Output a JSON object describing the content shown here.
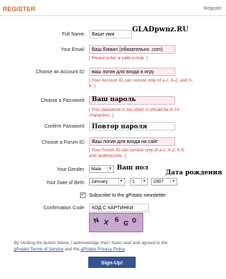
{
  "header": {
    "brand": "REGISTER",
    "link": "Register"
  },
  "watermark": "GLADpwnz.RU",
  "form": {
    "full_name": {
      "label": "Full Name",
      "value": "Ваше имя"
    },
    "email": {
      "label": "Your Email",
      "value": "Ваш Емаил (обязательно .com)",
      "error": "[ Please enter a valid e-mail. ]"
    },
    "account_id": {
      "label": "Choose an Account ID",
      "value": "ваш логин для входа в игру",
      "error": "[ Your Account ID can consist only of a-z, A-Z, and 0-9. ]"
    },
    "password": {
      "label": "Choose a Password",
      "annotation": "Ваш пароль",
      "error": "[ Your password is too short, it should be 6-14 characters. ]"
    },
    "confirm_password": {
      "label": "Confirm Password",
      "annotation": "Повтор пароля"
    },
    "forum_id": {
      "label": "Choose a Forum ID",
      "value": "Ваш логин для входа на сайт",
      "error": "[ Your Forum ID can consist only of a-z, A-Z, 0-9, and underscores. ]"
    },
    "gender": {
      "label": "Your Gender",
      "value": "Male",
      "annotation": "Ваш пол"
    },
    "birth": {
      "label": "Your Date of Birth",
      "month": "January",
      "day": "1",
      "year": "1997",
      "annotation": "Дата рождения"
    },
    "newsletter": {
      "label": "Subscribe to the gPotato newsletter",
      "checked": "✓"
    },
    "confirmation": {
      "label": "Confirmation Code",
      "value": "КОД С КАРТИНКИ"
    }
  },
  "captcha": {
    "chars": [
      "N",
      "X",
      "6",
      "G",
      "0"
    ]
  },
  "footer": {
    "text1": "By clicking the button below, I acknowledge that I have read and agreed to the",
    "tos": "gPotato Terms of Service",
    "and": " and the ",
    "privacy": "gPotato Privacy Policy",
    "end": "."
  },
  "submit_label": "Sign-Up!"
}
